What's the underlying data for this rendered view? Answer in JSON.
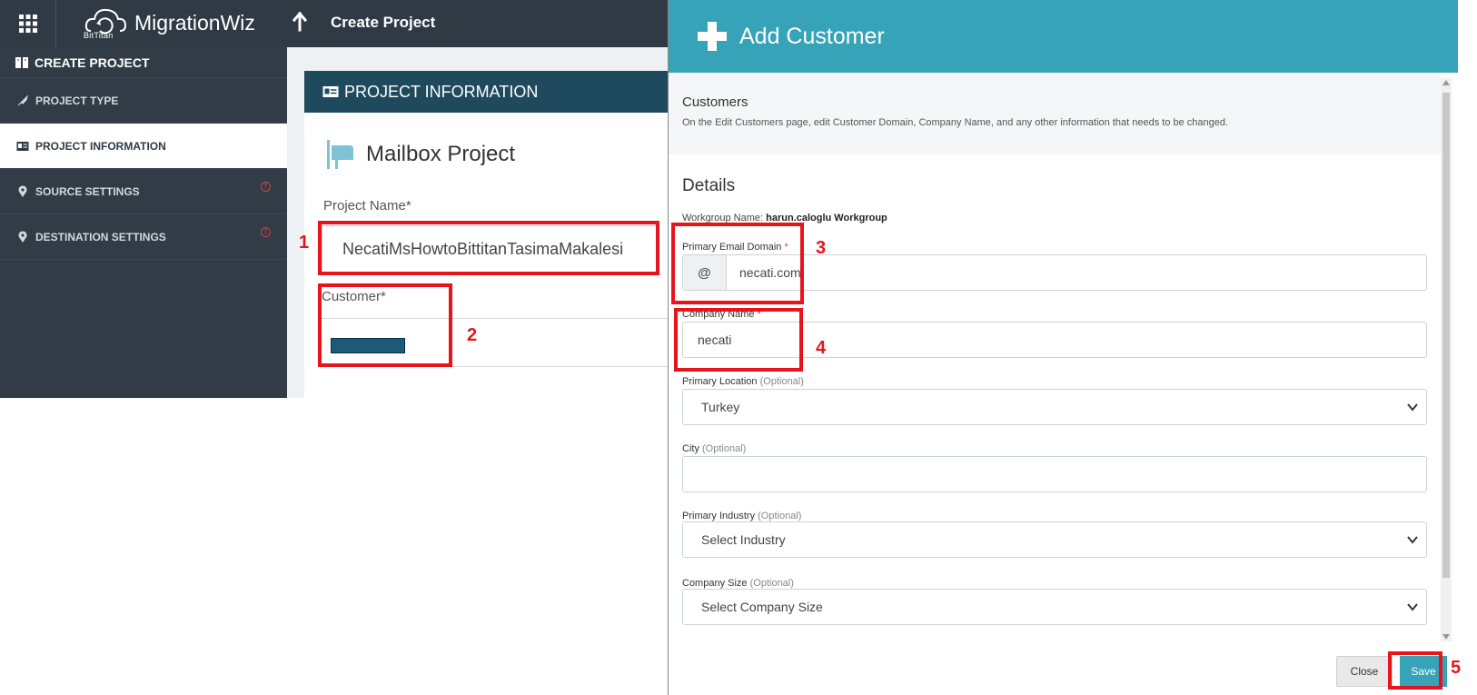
{
  "app": {
    "brand": "MigrationWiz",
    "brand_sub": "BitTitan",
    "page_title": "Create Project"
  },
  "sidebar": {
    "header": "CREATE PROJECT",
    "items": [
      {
        "label": "PROJECT TYPE",
        "icon": "rocket-icon"
      },
      {
        "label": "PROJECT INFORMATION",
        "icon": "id-card-icon"
      },
      {
        "label": "SOURCE SETTINGS",
        "icon": "location-pin-icon"
      },
      {
        "label": "DESTINATION SETTINGS",
        "icon": "location-pin-icon"
      }
    ]
  },
  "project_card": {
    "header": "PROJECT INFORMATION",
    "project_kind": "Mailbox Project",
    "project_name_label": "Project Name*",
    "project_name_value": "NecatiMsHowtoBittitanTasimaMakalesi",
    "customer_label": "Customer*"
  },
  "annotations": [
    "1",
    "2",
    "3",
    "4",
    "5"
  ],
  "modal": {
    "title": "Add Customer",
    "info_title": "Customers",
    "info_text": "On the Edit Customers page, edit Customer Domain, Company Name, and any other information that needs to be changed.",
    "details_title": "Details",
    "workgroup_label": "Workgroup Name:",
    "workgroup_value": "harun.caloglu Workgroup",
    "email_domain_label": "Primary Email Domain",
    "email_domain_prefix": "@",
    "email_domain_value": "necati.com",
    "company_name_label": "Company Name",
    "company_name_value": "necati",
    "required_mark": "*",
    "optional_mark": "(Optional)",
    "location_label": "Primary Location",
    "location_value": "Turkey",
    "city_label": "City",
    "city_value": "",
    "industry_label": "Primary Industry",
    "industry_value": "Select Industry",
    "size_label": "Company Size",
    "size_value": "Select Company Size",
    "close_label": "Close",
    "save_label": "Save"
  },
  "colors": {
    "topbar": "#2f3a44",
    "sidebar": "#323c46",
    "card_header": "#1f4a5d",
    "modal_accent": "#36a3b8",
    "annotation_red": "#e8141c"
  }
}
